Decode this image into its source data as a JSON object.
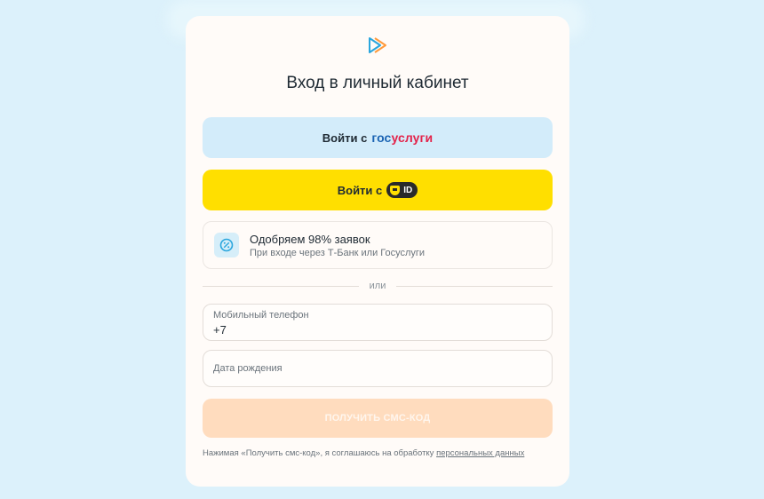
{
  "page": {
    "title": "Вход в личный кабинет"
  },
  "gosuslugi_button": {
    "prefix": "Войти с",
    "brand_part1": "гос",
    "brand_part2": "услуги"
  },
  "tid_button": {
    "prefix": "Войти с",
    "badge": "ID"
  },
  "promo": {
    "title": "Одобряем 98% заявок",
    "subtitle": "При входе через Т-Банк или Госуслуги"
  },
  "divider": {
    "text": "или"
  },
  "phone_field": {
    "label": "Мобильный телефон",
    "value": "+7"
  },
  "birth_field": {
    "label": "Дата рождения",
    "value": ""
  },
  "sms_button": {
    "label": "ПОЛУЧИТЬ СМС-КОД"
  },
  "consent": {
    "text": "Нажимая «Получить смс-код», я соглашаюсь на обработку ",
    "link": "персональных данных"
  },
  "colors": {
    "background": "#dcf1fb",
    "gosuslugi_bg": "#d3ecfa",
    "tid_bg": "#ffdf00",
    "sms_disabled_bg": "#ffdcbe",
    "logo_blue": "#2aa6dd",
    "logo_orange": "#ff9a3c"
  },
  "icons": {
    "logo": "play-logo-icon",
    "promo": "percent-badge-icon",
    "tid": "shield-icon"
  }
}
